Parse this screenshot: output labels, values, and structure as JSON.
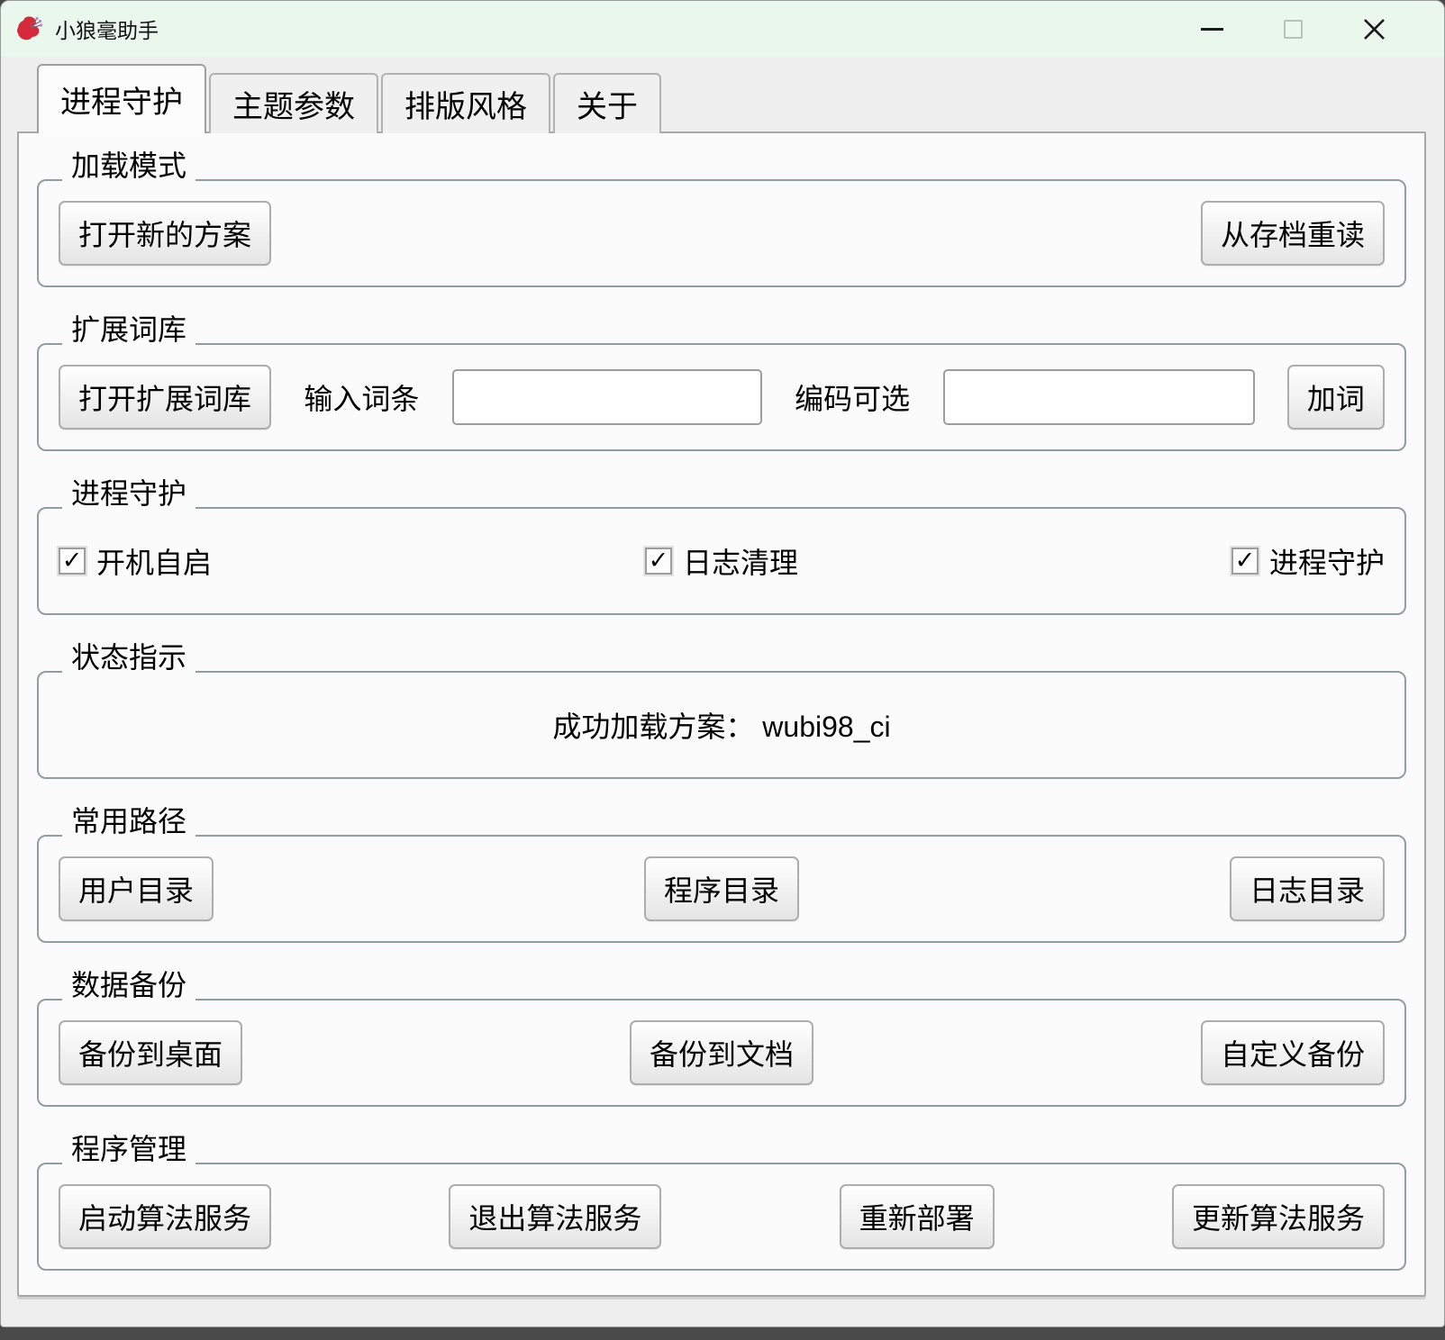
{
  "window": {
    "title": "小狼毫助手"
  },
  "titlebar_icons": {
    "app": "hibiscus-flower",
    "minimize": "minimize-line",
    "maximize": "maximize-box",
    "close": "close-x"
  },
  "tabs": [
    {
      "label": "进程守护",
      "active": true
    },
    {
      "label": "主题参数",
      "active": false
    },
    {
      "label": "排版风格",
      "active": false
    },
    {
      "label": "关于",
      "active": false
    }
  ],
  "glyphs": {
    "check": "✓"
  },
  "colors": {
    "titlebar": "#e9f7ec",
    "flower_red": "#d6293a",
    "window_body": "#eeeeee",
    "panel": "#fbfbfb",
    "group_border": "#8f9e9e"
  },
  "groups": {
    "load_mode": {
      "title": "加载模式",
      "open_new_button": "打开新的方案",
      "reload_button": "从存档重读"
    },
    "ext_dict": {
      "title": "扩展词库",
      "open_button": "打开扩展词库",
      "entry_label": "输入词条",
      "entry_value": "",
      "code_label": "编码可选",
      "code_value": "",
      "add_button": "加词"
    },
    "guard": {
      "title": "进程守护",
      "checkboxes": [
        {
          "label": "开机自启",
          "checked": true
        },
        {
          "label": "日志清理",
          "checked": true
        },
        {
          "label": "进程守护",
          "checked": true
        }
      ]
    },
    "status": {
      "title": "状态指示",
      "message": "成功加载方案： wubi98_ci"
    },
    "paths": {
      "title": "常用路径",
      "buttons": [
        "用户目录",
        "程序目录",
        "日志目录"
      ]
    },
    "backup": {
      "title": "数据备份",
      "buttons": [
        "备份到桌面",
        "备份到文档",
        "自定义备份"
      ]
    },
    "manage": {
      "title": "程序管理",
      "buttons": [
        "启动算法服务",
        "退出算法服务",
        "重新部署",
        "更新算法服务"
      ]
    }
  }
}
